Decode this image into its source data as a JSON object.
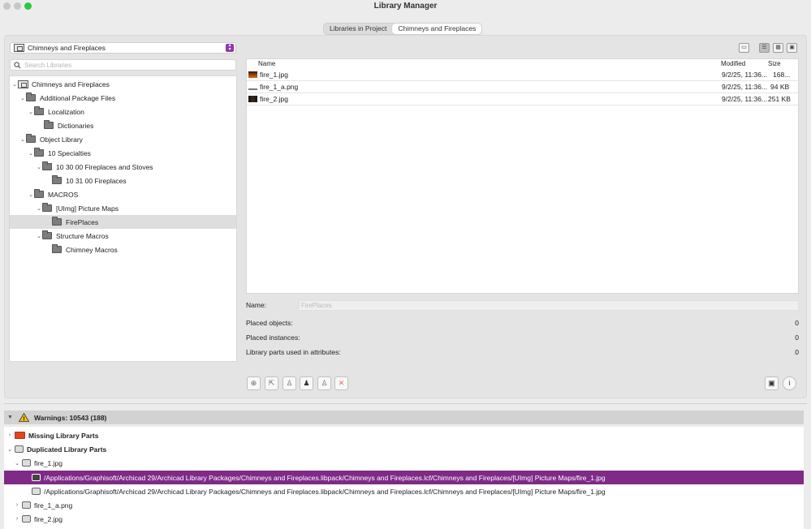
{
  "window": {
    "title": "Library Manager"
  },
  "tabs": [
    {
      "label": "Libraries in Project"
    },
    {
      "label": "Chimneys and Fireplaces"
    }
  ],
  "library_select": {
    "value": "Chimneys and Fireplaces"
  },
  "search": {
    "placeholder": "Search Libraries"
  },
  "tree": [
    {
      "label": "Chimneys and Fireplaces"
    },
    {
      "label": "Additional Package Files"
    },
    {
      "label": "Localization"
    },
    {
      "label": "Dictionaries"
    },
    {
      "label": "Object Library"
    },
    {
      "label": "10 Specialties"
    },
    {
      "label": "10 30 00 Fireplaces and Stoves"
    },
    {
      "label": "10 31 00 Fireplaces"
    },
    {
      "label": "MACROS"
    },
    {
      "label": "[UImg] Picture Maps"
    },
    {
      "label": "FirePlaces"
    },
    {
      "label": "Structure Macros"
    },
    {
      "label": "Chimney Macros"
    }
  ],
  "file_table": {
    "headers": {
      "name": "Name",
      "modified": "Modified",
      "size": "Size"
    },
    "rows": [
      {
        "name": "fire_1.jpg",
        "modified": "9/2/25, 11:36...",
        "size": "168..."
      },
      {
        "name": "fire_1_a.png",
        "modified": "9/2/25, 11:36...",
        "size": "94 KB"
      },
      {
        "name": "fire_2.jpg",
        "modified": "9/2/25, 11:36...",
        "size": "251 KB"
      }
    ]
  },
  "properties": {
    "name_label": "Name:",
    "name_value": "FirePlaces",
    "placed_objects_label": "Placed objects:",
    "placed_objects_value": "0",
    "placed_instances_label": "Placed instances:",
    "placed_instances_value": "0",
    "library_parts_label": "Library parts used in attributes:",
    "library_parts_value": "0"
  },
  "warnings": {
    "header": "Warnings: 10543 (188)",
    "rows": [
      {
        "label": "Missing Library Parts"
      },
      {
        "label": "Duplicated Library Parts"
      },
      {
        "label": "fire_1.jpg"
      },
      {
        "label": "/Applications/Graphisoft/Archicad 29/Archicad Library Packages/Chimneys and Fireplaces.libpack/Chimneys and Fireplaces.lcf/Chimneys and Fireplaces/[UImg] Picture Maps/fire_1.jpg"
      },
      {
        "label": "/Applications/Graphisoft/Archicad 29/Archicad Library Packages/Chimneys and Fireplaces.libpack/Chimneys and Fireplaces.lcf/Chimneys and Fireplaces/[UImg] Picture Maps/fire_1.jpg"
      },
      {
        "label": "fire_1_a.png"
      },
      {
        "label": "fire_2.jpg"
      }
    ]
  },
  "colors": {
    "accent": "#8e3aa6",
    "selection": "#7f2a87",
    "warning_red": "#e2441b"
  }
}
